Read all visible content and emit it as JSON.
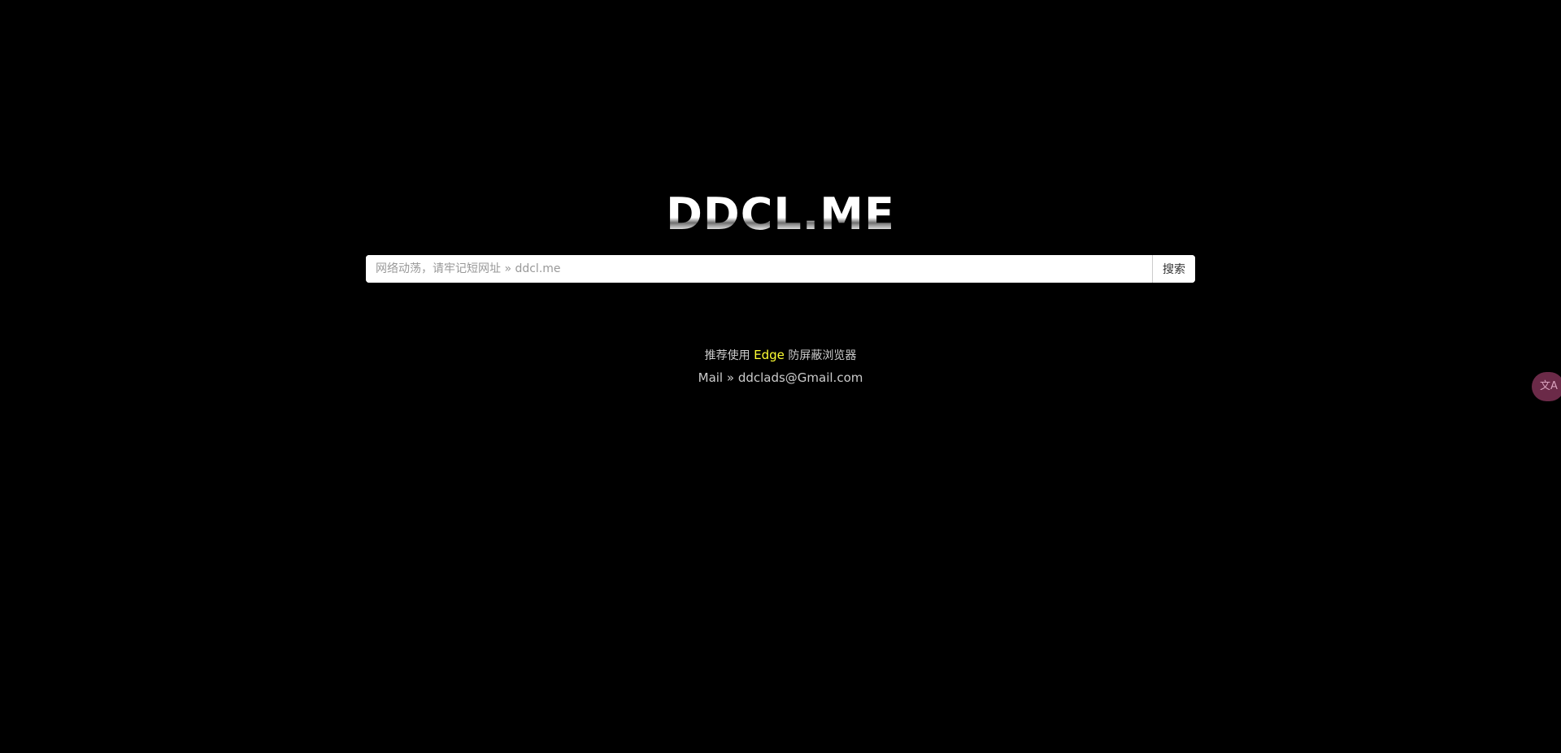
{
  "logo": {
    "text": "DDCL.ME"
  },
  "search": {
    "placeholder": "网络动荡，请牢记短网址 » ddcl.me",
    "value": "",
    "button_label": "搜索"
  },
  "footer": {
    "recommend_prefix": "推荐使用 ",
    "recommend_link": "Edge",
    "recommend_suffix": " 防屏蔽浏览器",
    "mail_prefix": "Mail » ",
    "mail_address": "ddclads@Gmail.com"
  },
  "translate_widget": {
    "icon": "translate-icon",
    "glyph": "文A"
  },
  "colors": {
    "background": "#000000",
    "link_accent": "#ffff33",
    "footer_text": "#cccccc",
    "widget_bg": "#6b2a48"
  }
}
